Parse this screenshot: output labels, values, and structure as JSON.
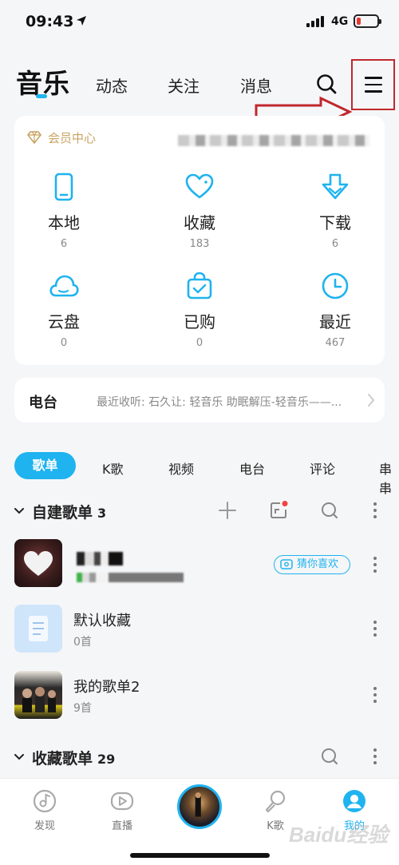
{
  "status_bar": {
    "time": "09:43",
    "network": "4G",
    "battery_level": 0.2,
    "battery_color": "#e53935"
  },
  "top_nav": {
    "active_tab": "音乐",
    "tabs": [
      "动态",
      "关注",
      "消息"
    ],
    "icons": {
      "search": "search-icon",
      "menu": "menu-icon"
    }
  },
  "member_card": {
    "vip_label": "会员中心",
    "items": [
      {
        "label": "本地",
        "count": "6",
        "icon": "phone-icon"
      },
      {
        "label": "收藏",
        "count": "183",
        "icon": "heart-icon"
      },
      {
        "label": "下载",
        "count": "6",
        "icon": "download-icon"
      },
      {
        "label": "云盘",
        "count": "0",
        "icon": "cloud-icon"
      },
      {
        "label": "已购",
        "count": "0",
        "icon": "bag-icon"
      },
      {
        "label": "最近",
        "count": "467",
        "icon": "clock-icon"
      }
    ]
  },
  "radio": {
    "title": "电台",
    "recent": "最近收听: 石久让: 轻音乐 助眠解压-轻音乐——..."
  },
  "category_tabs": {
    "active": "歌单",
    "tabs": [
      "K歌",
      "视频",
      "电台",
      "评论",
      "串串"
    ]
  },
  "sections": {
    "created": {
      "title": "自建歌单",
      "count": "3"
    },
    "collected": {
      "title": "收藏歌单",
      "count": "29"
    }
  },
  "playlists": [
    {
      "title": "",
      "subtitle": "",
      "badge": "猜你喜欢"
    },
    {
      "title": "默认收藏",
      "subtitle": "0首"
    },
    {
      "title": "我的歌单2",
      "subtitle": "9首"
    }
  ],
  "bottom_nav": {
    "items": [
      {
        "label": "发现",
        "icon": "disc-icon"
      },
      {
        "label": "直播",
        "icon": "live-icon"
      },
      {
        "label": "K歌",
        "icon": "microphone-icon"
      },
      {
        "label": "我的",
        "icon": "profile-icon"
      }
    ],
    "active": "我的"
  },
  "colors": {
    "accent": "#1fb3ef",
    "gold": "#c9a463",
    "annotation": "#c0272d"
  },
  "watermark": "Baidu经验"
}
